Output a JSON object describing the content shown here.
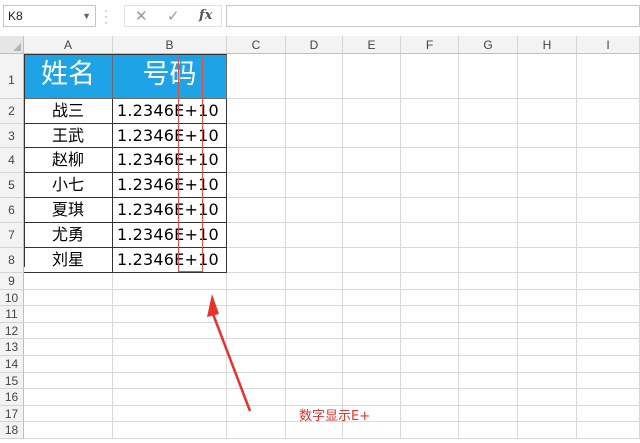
{
  "formula_bar": {
    "name_box": "K8",
    "cancel_icon": "✕",
    "enter_icon": "✓",
    "function_icon": "fx",
    "formula": ""
  },
  "columns": [
    "A",
    "B",
    "C",
    "D",
    "E",
    "F",
    "G",
    "H",
    "I"
  ],
  "rows": [
    "1",
    "2",
    "3",
    "4",
    "5",
    "6",
    "7",
    "8",
    "9",
    "10",
    "11",
    "12",
    "13",
    "14",
    "15",
    "16",
    "17",
    "18"
  ],
  "table": {
    "header": [
      "姓名",
      "号码"
    ],
    "rows": [
      {
        "name": "战三",
        "number": "1.2346E+10"
      },
      {
        "name": "王武",
        "number": "1.2346E+10"
      },
      {
        "name": "赵柳",
        "number": "1.2346E+10"
      },
      {
        "name": "小七",
        "number": "1.2346E+10"
      },
      {
        "name": "夏琪",
        "number": "1.2346E+10"
      },
      {
        "name": "尤勇",
        "number": "1.2346E+10"
      },
      {
        "name": "刘星",
        "number": "1.2346E+10"
      }
    ],
    "header_color": "#1ea3e6"
  },
  "annotation": {
    "text": "数字显示E+",
    "color": "#e8322a"
  }
}
